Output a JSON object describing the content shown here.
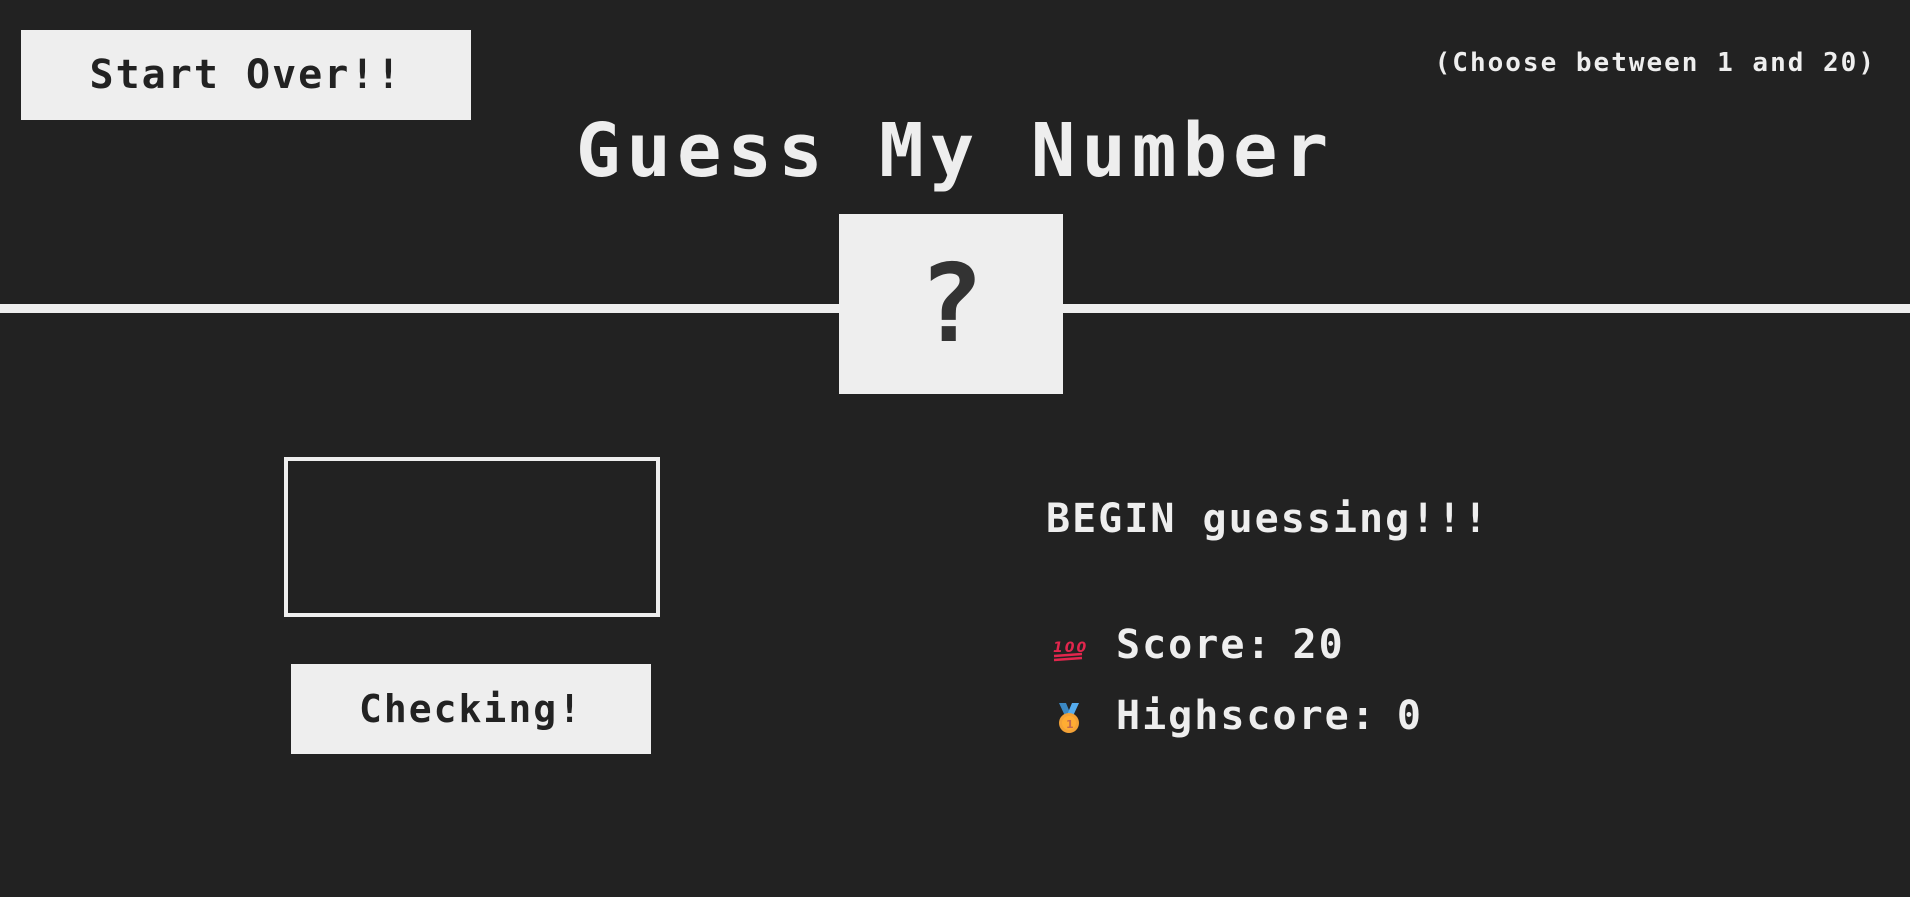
{
  "header": {
    "again_label": "Start Over!!",
    "between_text": "(Choose between 1 and 20)",
    "title": "Guess My Number",
    "secret_number": "?"
  },
  "left": {
    "guess_value": "",
    "check_label": "Checking!"
  },
  "right": {
    "message": "BEGIN guessing!!!",
    "score_icon": "hundred-points-icon",
    "score_label": "Score:",
    "score_value": "20",
    "highscore_icon": "first-place-medal-icon",
    "highscore_label": "Highscore:",
    "highscore_value": "0"
  },
  "colors": {
    "background": "#222222",
    "foreground": "#eeeeee",
    "score_icon": "#e2264d",
    "medal_gold": "#f4a236",
    "medal_ribbon": "#3b88c3"
  }
}
